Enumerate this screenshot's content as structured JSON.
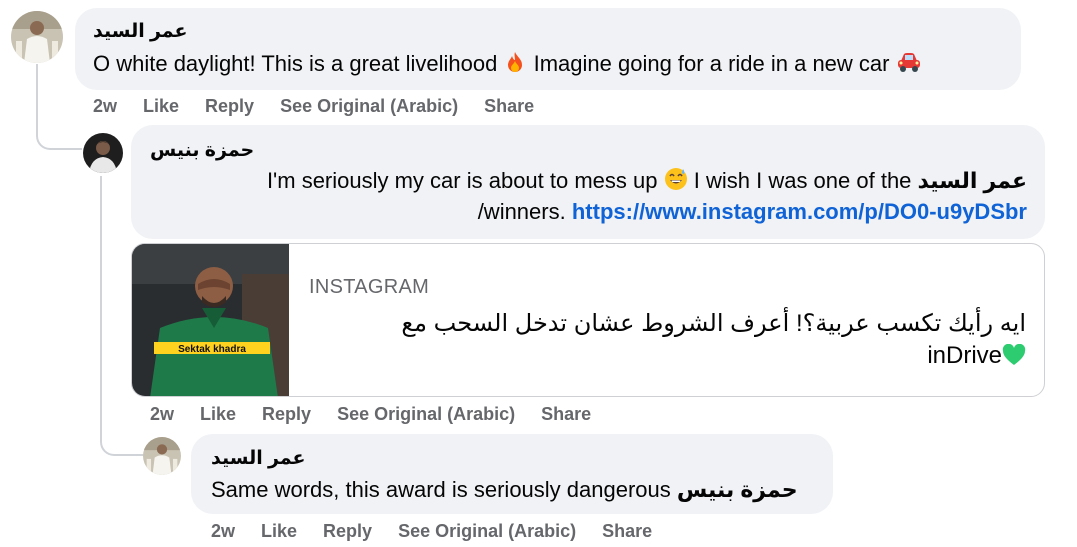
{
  "comments": [
    {
      "author": "عمر السيد",
      "text_parts": [
        "O white daylight! This is a great livelihood",
        "Imagine going for a ride in a new car"
      ],
      "emojis": [
        "fire-emoji",
        "car-emoji"
      ],
      "actions": {
        "time": "2w",
        "like": "Like",
        "reply": "Reply",
        "see_original": "See Original (Arabic)",
        "share": "Share"
      }
    },
    {
      "author": "حمزة بنيس",
      "line1_text": "I'm seriously my car is about to mess up",
      "line1_text2": "I wish I was one of the",
      "line1_mention": "عمر السيد",
      "line2_text": "/winners.",
      "line2_link": "https://www.instagram.com/p/DO0-u9yDSbr",
      "emoji": "grinning-sweat-emoji",
      "preview": {
        "source": "INSTAGRAM",
        "title_line1": "ايه رأيك تكسب عربية؟! أعرف الشروط عشان تدخل السحب مع",
        "title_line2": "inDrive",
        "thumb_caption": "Sektak khadra",
        "heart": "green-heart-emoji"
      },
      "actions": {
        "time": "2w",
        "like": "Like",
        "reply": "Reply",
        "see_original": "See Original (Arabic)",
        "share": "Share"
      }
    },
    {
      "author": "عمر السيد",
      "text": "Same words, this award is seriously dangerous",
      "mention": "حمزة بنيس",
      "actions": {
        "time": "2w",
        "like": "Like",
        "reply": "Reply",
        "see_original": "See Original (Arabic)",
        "share": "Share"
      }
    }
  ],
  "colors": {
    "bubble": "#f0f2f5",
    "link": "#0f63d6",
    "meta": "#65676b",
    "heart": "#2ecc71",
    "thumb_bg": "#2a2d30"
  }
}
